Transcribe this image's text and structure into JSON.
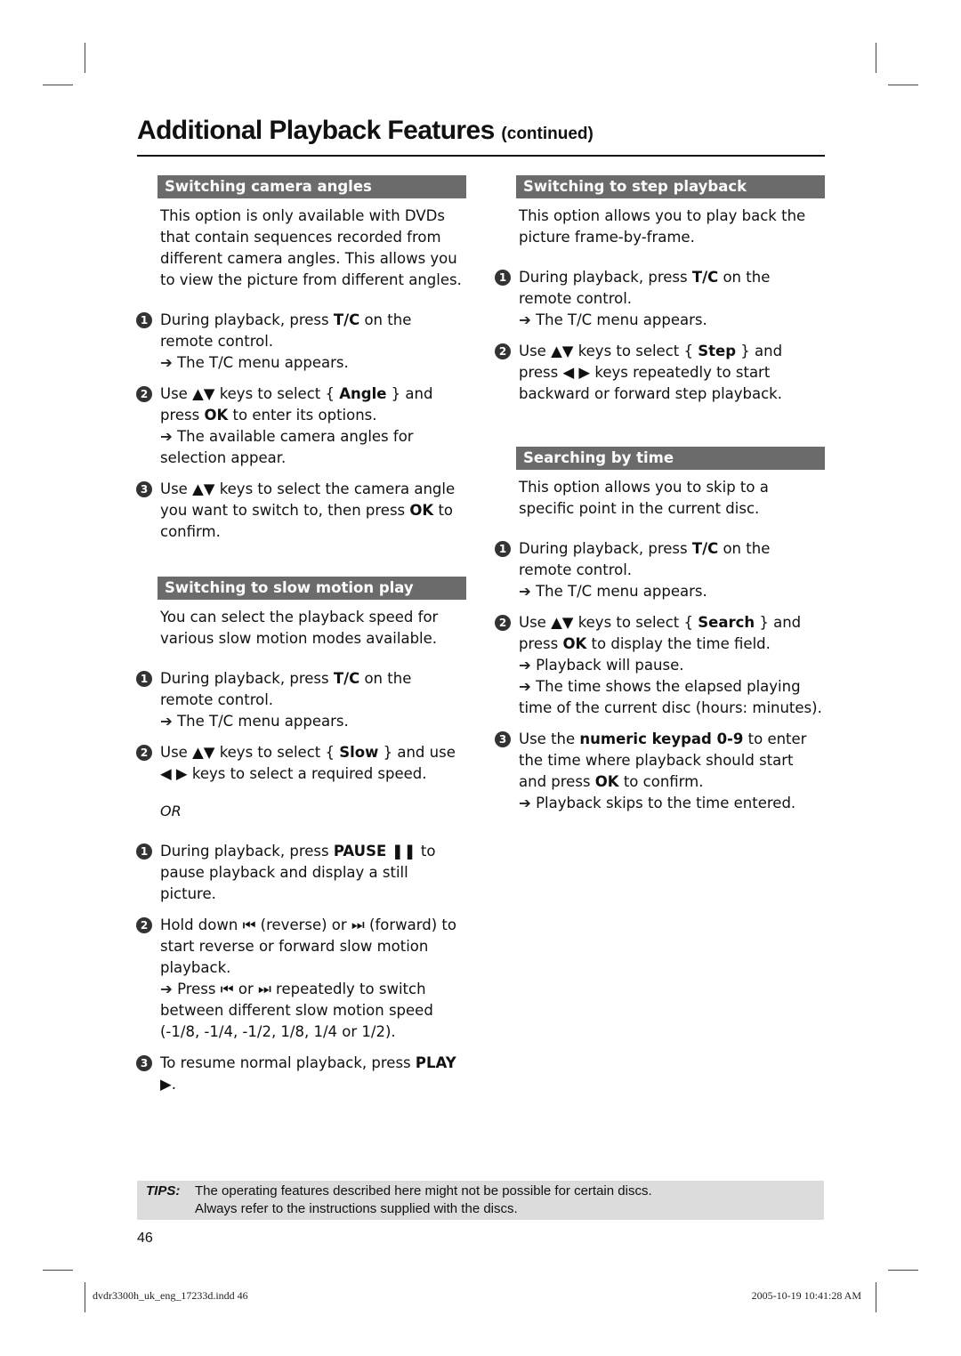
{
  "page_title": "Additional Playback Features",
  "page_title_suffix": "(continued)",
  "left": {
    "camera": {
      "heading": "Switching camera angles",
      "intro": "This option is only available with DVDs that contain sequences recorded from different camera angles. This allows you to view the picture from different angles.",
      "steps": [
        {
          "num": "1",
          "pre": "During playback, press ",
          "bold": "T/C",
          "post": " on the remote control.",
          "result": "The T/C menu appears."
        },
        {
          "num": "2",
          "pre": "Use ▲▼ keys to select { ",
          "bold": "Angle",
          "post": " } and press ",
          "bold2": "OK",
          "post2": " to enter its options.",
          "result": "The available camera angles for selection appear."
        },
        {
          "num": "3",
          "pre": "Use ▲▼ keys to select the camera angle you want to switch to, then press ",
          "bold": "OK",
          "post": " to confirm."
        }
      ]
    },
    "slow": {
      "heading": "Switching to slow motion play",
      "intro": "You can select the playback speed for various slow motion modes available.",
      "steps": [
        {
          "num": "1",
          "pre": "During playback, press ",
          "bold": "T/C",
          "post": " on the remote control.",
          "result": "The T/C menu appears."
        },
        {
          "num": "2",
          "pre": "Use ▲▼ keys to select { ",
          "bold": "Slow",
          "post": " } and use ◀ ▶ keys to select a required speed."
        }
      ],
      "or_label": "OR",
      "alt_steps": [
        {
          "num": "1",
          "pre": "During playback, press ",
          "bold": "PAUSE ❚❚",
          "post": "  to pause playback and display a still picture."
        },
        {
          "num": "2",
          "pre": "Hold down ⏮ (reverse) or ⏭ (forward) to start reverse or forward slow motion playback.",
          "result": "Press ⏮ or ⏭ repeatedly to switch between different slow motion speed (-1/8, -1/4, -1/2, 1/8, 1/4 or 1/2)."
        },
        {
          "num": "3",
          "pre": "To resume normal playback, press ",
          "bold": "PLAY ▶",
          "post": "."
        }
      ]
    }
  },
  "right": {
    "step": {
      "heading": "Switching to step playback",
      "intro": "This option allows you to play back the picture frame-by-frame.",
      "steps": [
        {
          "num": "1",
          "pre": "During playback, press ",
          "bold": "T/C",
          "post": " on the remote control.",
          "result": "The T/C menu appears."
        },
        {
          "num": "2",
          "pre": "Use ▲▼ keys to select { ",
          "bold": "Step",
          "post": " } and press ◀ ▶ keys repeatedly to start backward or forward step playback."
        }
      ]
    },
    "search": {
      "heading": "Searching by time",
      "intro": "This option allows you to skip to a specific point in the current disc.",
      "steps": [
        {
          "num": "1",
          "pre": "During playback, press ",
          "bold": "T/C",
          "post": " on the remote control.",
          "result": "The T/C menu appears."
        },
        {
          "num": "2",
          "pre": "Use ▲▼ keys to select { ",
          "bold": "Search",
          "post": " } and press ",
          "bold2": "OK",
          "post2": " to display the time field.",
          "result": "Playback will pause.",
          "result2": "The time shows the elapsed playing time of the current disc (hours: minutes)."
        },
        {
          "num": "3",
          "pre": "Use the ",
          "bold": "numeric keypad 0-9",
          "post": " to enter the time where playback should start and press ",
          "bold2": "OK",
          "post2": " to confirm.",
          "result": "Playback skips to the time entered."
        }
      ]
    }
  },
  "tips": {
    "label": "TIPS:",
    "line1": "The operating features described here might not be possible for certain discs.",
    "line2": "Always refer to the instructions supplied with the discs."
  },
  "page_number": "46",
  "slug_left": "dvdr3300h_uk_eng_17233d.indd   46",
  "slug_right": "2005-10-19   10:41:28 AM",
  "arrow_glyph": "➔"
}
